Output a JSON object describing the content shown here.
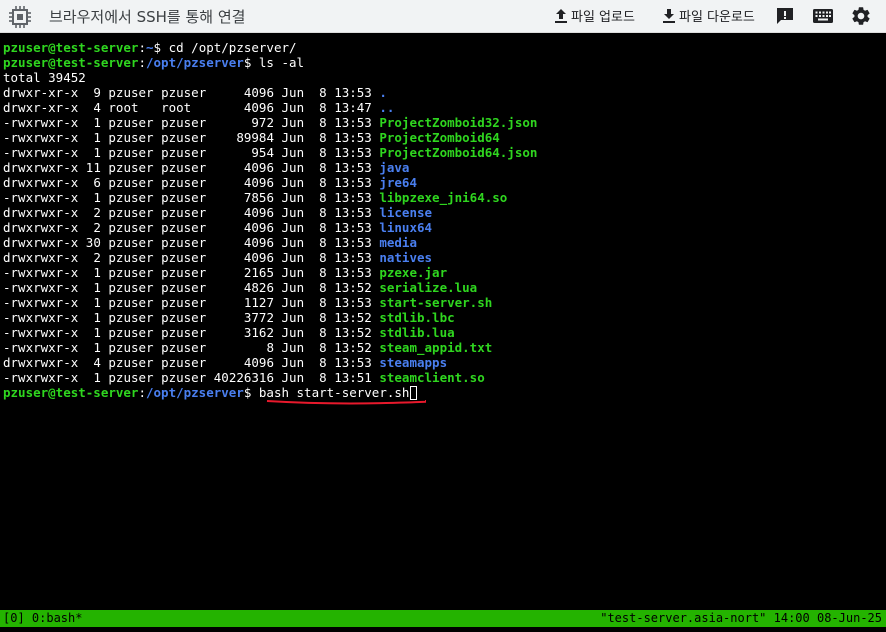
{
  "window": {
    "title": "브라우저에서 SSH를 통해 연결",
    "upload_label": "파일 업로드",
    "download_label": "파일 다운로드"
  },
  "icons": {
    "app": "chip-icon",
    "upload": "upload-icon",
    "download": "download-icon",
    "feedback": "feedback-icon",
    "keyboard": "keyboard-icon",
    "settings": "gear-icon"
  },
  "colors": {
    "terminal_bg": "#000000",
    "prompt_green": "#2fd61f",
    "dir_blue": "#4a7ff0",
    "status_bar": "#24b300",
    "annotation_red": "#e8192c"
  },
  "terminal": {
    "prompt_user_host": "pzuser@test-server",
    "cmd1": {
      "user_host": "pzuser@test-server",
      "sep": ":",
      "path": "~",
      "dollar": "$ ",
      "command": "cd /opt/pzserver/"
    },
    "cmd2": {
      "user_host": "pzuser@test-server",
      "sep": ":",
      "path": "/opt/pzserver",
      "dollar": "$ ",
      "command": "ls -al"
    },
    "total": "total 39452",
    "listing": [
      {
        "perm": "drwxr-xr-x",
        "links": " 9",
        "owner": "pzuser",
        "group": "pzuser",
        "size": "    4096",
        "date": "Jun  8 13:53",
        "name": ".",
        "kind": "dir"
      },
      {
        "perm": "drwxr-xr-x",
        "links": " 4",
        "owner": "root  ",
        "group": "root  ",
        "size": "    4096",
        "date": "Jun  8 13:47",
        "name": "..",
        "kind": "dir"
      },
      {
        "perm": "-rwxrwxr-x",
        "links": " 1",
        "owner": "pzuser",
        "group": "pzuser",
        "size": "     972",
        "date": "Jun  8 13:53",
        "name": "ProjectZomboid32.json",
        "kind": "exec"
      },
      {
        "perm": "-rwxrwxr-x",
        "links": " 1",
        "owner": "pzuser",
        "group": "pzuser",
        "size": "   89984",
        "date": "Jun  8 13:53",
        "name": "ProjectZomboid64",
        "kind": "exec"
      },
      {
        "perm": "-rwxrwxr-x",
        "links": " 1",
        "owner": "pzuser",
        "group": "pzuser",
        "size": "     954",
        "date": "Jun  8 13:53",
        "name": "ProjectZomboid64.json",
        "kind": "exec"
      },
      {
        "perm": "drwxrwxr-x",
        "links": "11",
        "owner": "pzuser",
        "group": "pzuser",
        "size": "    4096",
        "date": "Jun  8 13:53",
        "name": "java",
        "kind": "dir"
      },
      {
        "perm": "drwxrwxr-x",
        "links": " 6",
        "owner": "pzuser",
        "group": "pzuser",
        "size": "    4096",
        "date": "Jun  8 13:53",
        "name": "jre64",
        "kind": "dir"
      },
      {
        "perm": "-rwxrwxr-x",
        "links": " 1",
        "owner": "pzuser",
        "group": "pzuser",
        "size": "    7856",
        "date": "Jun  8 13:53",
        "name": "libpzexe_jni64.so",
        "kind": "exec"
      },
      {
        "perm": "drwxrwxr-x",
        "links": " 2",
        "owner": "pzuser",
        "group": "pzuser",
        "size": "    4096",
        "date": "Jun  8 13:53",
        "name": "license",
        "kind": "dir"
      },
      {
        "perm": "drwxrwxr-x",
        "links": " 2",
        "owner": "pzuser",
        "group": "pzuser",
        "size": "    4096",
        "date": "Jun  8 13:53",
        "name": "linux64",
        "kind": "dir"
      },
      {
        "perm": "drwxrwxr-x",
        "links": "30",
        "owner": "pzuser",
        "group": "pzuser",
        "size": "    4096",
        "date": "Jun  8 13:53",
        "name": "media",
        "kind": "dir"
      },
      {
        "perm": "drwxrwxr-x",
        "links": " 2",
        "owner": "pzuser",
        "group": "pzuser",
        "size": "    4096",
        "date": "Jun  8 13:53",
        "name": "natives",
        "kind": "dir"
      },
      {
        "perm": "-rwxrwxr-x",
        "links": " 1",
        "owner": "pzuser",
        "group": "pzuser",
        "size": "    2165",
        "date": "Jun  8 13:53",
        "name": "pzexe.jar",
        "kind": "exec"
      },
      {
        "perm": "-rwxrwxr-x",
        "links": " 1",
        "owner": "pzuser",
        "group": "pzuser",
        "size": "    4826",
        "date": "Jun  8 13:52",
        "name": "serialize.lua",
        "kind": "exec"
      },
      {
        "perm": "-rwxrwxr-x",
        "links": " 1",
        "owner": "pzuser",
        "group": "pzuser",
        "size": "    1127",
        "date": "Jun  8 13:53",
        "name": "start-server.sh",
        "kind": "exec"
      },
      {
        "perm": "-rwxrwxr-x",
        "links": " 1",
        "owner": "pzuser",
        "group": "pzuser",
        "size": "    3772",
        "date": "Jun  8 13:52",
        "name": "stdlib.lbc",
        "kind": "exec"
      },
      {
        "perm": "-rwxrwxr-x",
        "links": " 1",
        "owner": "pzuser",
        "group": "pzuser",
        "size": "    3162",
        "date": "Jun  8 13:52",
        "name": "stdlib.lua",
        "kind": "exec"
      },
      {
        "perm": "-rwxrwxr-x",
        "links": " 1",
        "owner": "pzuser",
        "group": "pzuser",
        "size": "       8",
        "date": "Jun  8 13:52",
        "name": "steam_appid.txt",
        "kind": "exec"
      },
      {
        "perm": "drwxrwxr-x",
        "links": " 4",
        "owner": "pzuser",
        "group": "pzuser",
        "size": "    4096",
        "date": "Jun  8 13:53",
        "name": "steamapps",
        "kind": "dir"
      },
      {
        "perm": "-rwxrwxr-x",
        "links": " 1",
        "owner": "pzuser",
        "group": "pzuser",
        "size": "40226316",
        "date": "Jun  8 13:51",
        "name": "steamclient.so",
        "kind": "exec"
      }
    ],
    "cmd3": {
      "user_host": "pzuser@test-server",
      "sep": ":",
      "path": "/opt/pzserver",
      "dollar": "$ ",
      "command": "bash start-server.sh"
    }
  },
  "statusbar": {
    "left": "[0] 0:bash*",
    "right": "\"test-server.asia-nort\" 14:00 08-Jun-25"
  }
}
